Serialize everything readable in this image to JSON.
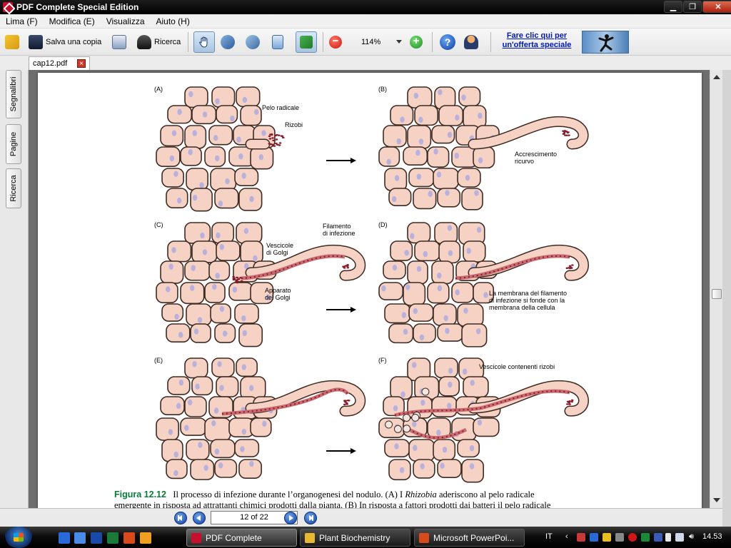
{
  "window": {
    "title": "PDF Complete Special Edition"
  },
  "menu": [
    "Lima (F)",
    "Modifica (E)",
    "Visualizza",
    "Aiuto (H)"
  ],
  "toolbar": {
    "save_copy_label": "Salva una copia",
    "search_label": "Ricerca",
    "zoom": "114%",
    "offer_line1": "Fare clic qui per",
    "offer_line2": "un'offerta speciale"
  },
  "tab": {
    "label": "cap12.pdf",
    "close_glyph": "×"
  },
  "sidebar": [
    "Segnalibri",
    "Pagine",
    "Ricerca"
  ],
  "figure": {
    "panels": [
      "(A)",
      "(B)",
      "(C)",
      "(D)",
      "(E)",
      "(F)"
    ],
    "labels": {
      "pelo": "Pelo radicale",
      "rizobi": "Rizobi",
      "accr1": "Accrescimento",
      "accr2": "ricurvo",
      "fil1": "Filamento",
      "fil2": "di infezione",
      "ves1": "Vescicole",
      "ves2": "di Golgi",
      "app1": "Apparato",
      "app2": "del Golgi",
      "mem1": "La membrana del filamento",
      "mem2": "di infezione si fonde con la",
      "mem3": "membrana della cellula",
      "vesriz": "Vescicole contenenti rizobi"
    },
    "caption_label": "Figura 12.12",
    "caption_line1_a": "Il processo di infezione durante l’organogenesi del nodulo. (A) I ",
    "caption_line1_em": "Rhizobia",
    "caption_line1_b": " aderiscono al pelo radicale",
    "caption_line2": "emergente in risposta ad attrattanti chimici prodotti dalla pianta. (B) In risposta a fattori prodotti dai batteri il pelo radicale"
  },
  "nav": {
    "page_display": "12 of 22"
  },
  "taskbar": {
    "tasks": [
      "PDF Complete",
      "Plant Biochemistry",
      "Microsoft PowerPoi..."
    ],
    "lang": "IT",
    "time": "14.53"
  },
  "colors": {
    "cell_fill": "#f6d2c4",
    "cell_stroke": "#3d2a22",
    "nucleus": "#b9b1dc",
    "bacteria": "#8b1a2a",
    "caption_label": "#0a7a3a"
  }
}
